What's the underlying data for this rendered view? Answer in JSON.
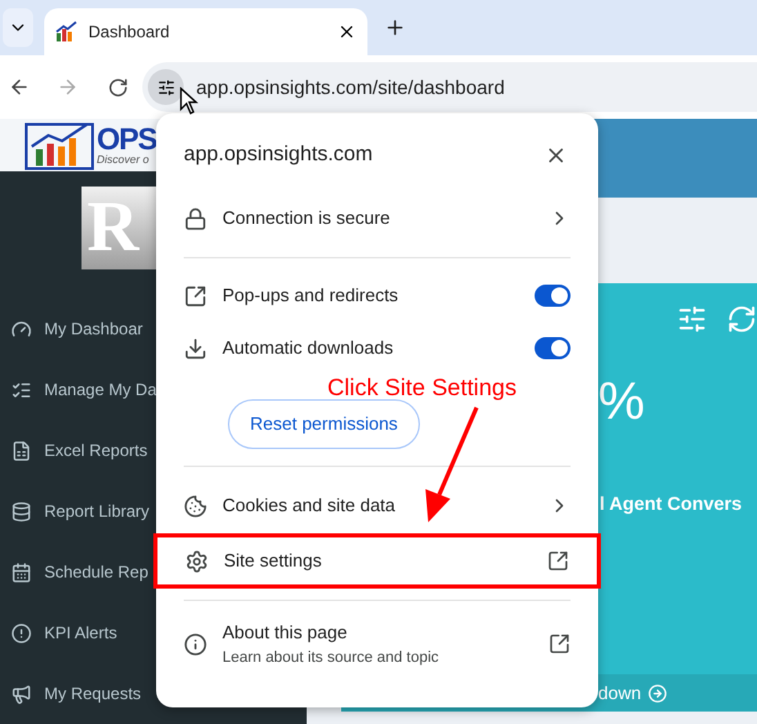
{
  "browser": {
    "tabs": [
      {
        "title": "Dashboard",
        "selected": true
      }
    ],
    "url": "app.opsinsights.com/site/dashboard"
  },
  "page": {
    "logo": {
      "text": "OPS",
      "tagline": "Discover o"
    },
    "client_logo": "R",
    "sidebar": {
      "items": [
        {
          "label": "My Dashboar"
        },
        {
          "label": "Manage My Da"
        },
        {
          "label": "Excel Reports"
        },
        {
          "label": "Report Library"
        },
        {
          "label": "Schedule Rep"
        },
        {
          "label": "KPI Alerts"
        },
        {
          "label": "My Requests"
        }
      ]
    },
    "card": {
      "value": "%",
      "title": "l Agent Convers",
      "footer_link": "down"
    }
  },
  "site_info_popup": {
    "title": "app.opsinsights.com",
    "sections": [
      [
        {
          "kind": "nav",
          "label": "Connection is secure"
        }
      ],
      [
        {
          "kind": "toggle",
          "label": "Pop-ups and redirects",
          "on": true
        },
        {
          "kind": "toggle",
          "label": "Automatic downloads",
          "on": true
        },
        {
          "kind": "button",
          "label": "Reset permissions"
        }
      ],
      [
        {
          "kind": "nav",
          "label": "Cookies and site data"
        },
        {
          "kind": "external",
          "label": "Site settings",
          "highlighted": true
        }
      ],
      [
        {
          "kind": "external",
          "label": "About this page",
          "subtitle": "Learn about its source and topic"
        }
      ]
    ]
  },
  "annotation": {
    "text": "Click Site Settings"
  }
}
